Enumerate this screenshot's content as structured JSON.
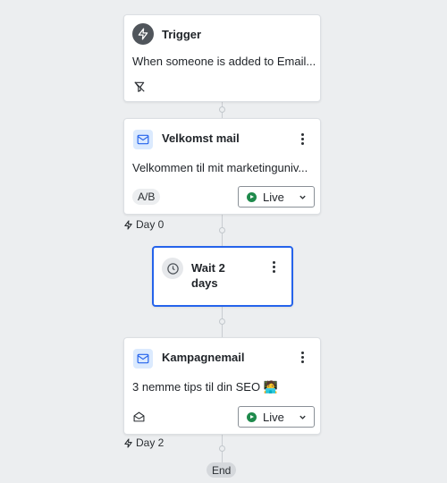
{
  "trigger": {
    "title": "Trigger",
    "description": "When someone is added to Email...",
    "icon": "lightning-icon",
    "filter_icon": "filter-off-icon"
  },
  "welcome_email": {
    "title": "Velkomst mail",
    "description": "Velkommen til mit marketinguniv...",
    "badge": "A/B",
    "status": "Live",
    "icon": "mail-icon"
  },
  "day_0": {
    "label": "Day 0"
  },
  "wait_step": {
    "title": "Wait 2 days",
    "title_line1": "Wait 2",
    "title_line2": "days",
    "icon": "clock-icon"
  },
  "campaign_email": {
    "title": "Kampagnemail",
    "description": "3 nemme tips til din SEO 🧑‍💻",
    "status": "Live",
    "icon": "mail-icon",
    "footer_icon": "envelope-open-icon"
  },
  "day_2": {
    "label": "Day 2"
  },
  "end": {
    "label": "End"
  },
  "colors": {
    "background": "#eceef0",
    "selected_border": "#2563eb",
    "live_green": "#1f8a4c",
    "mail_icon_bg": "#dbeafe"
  }
}
